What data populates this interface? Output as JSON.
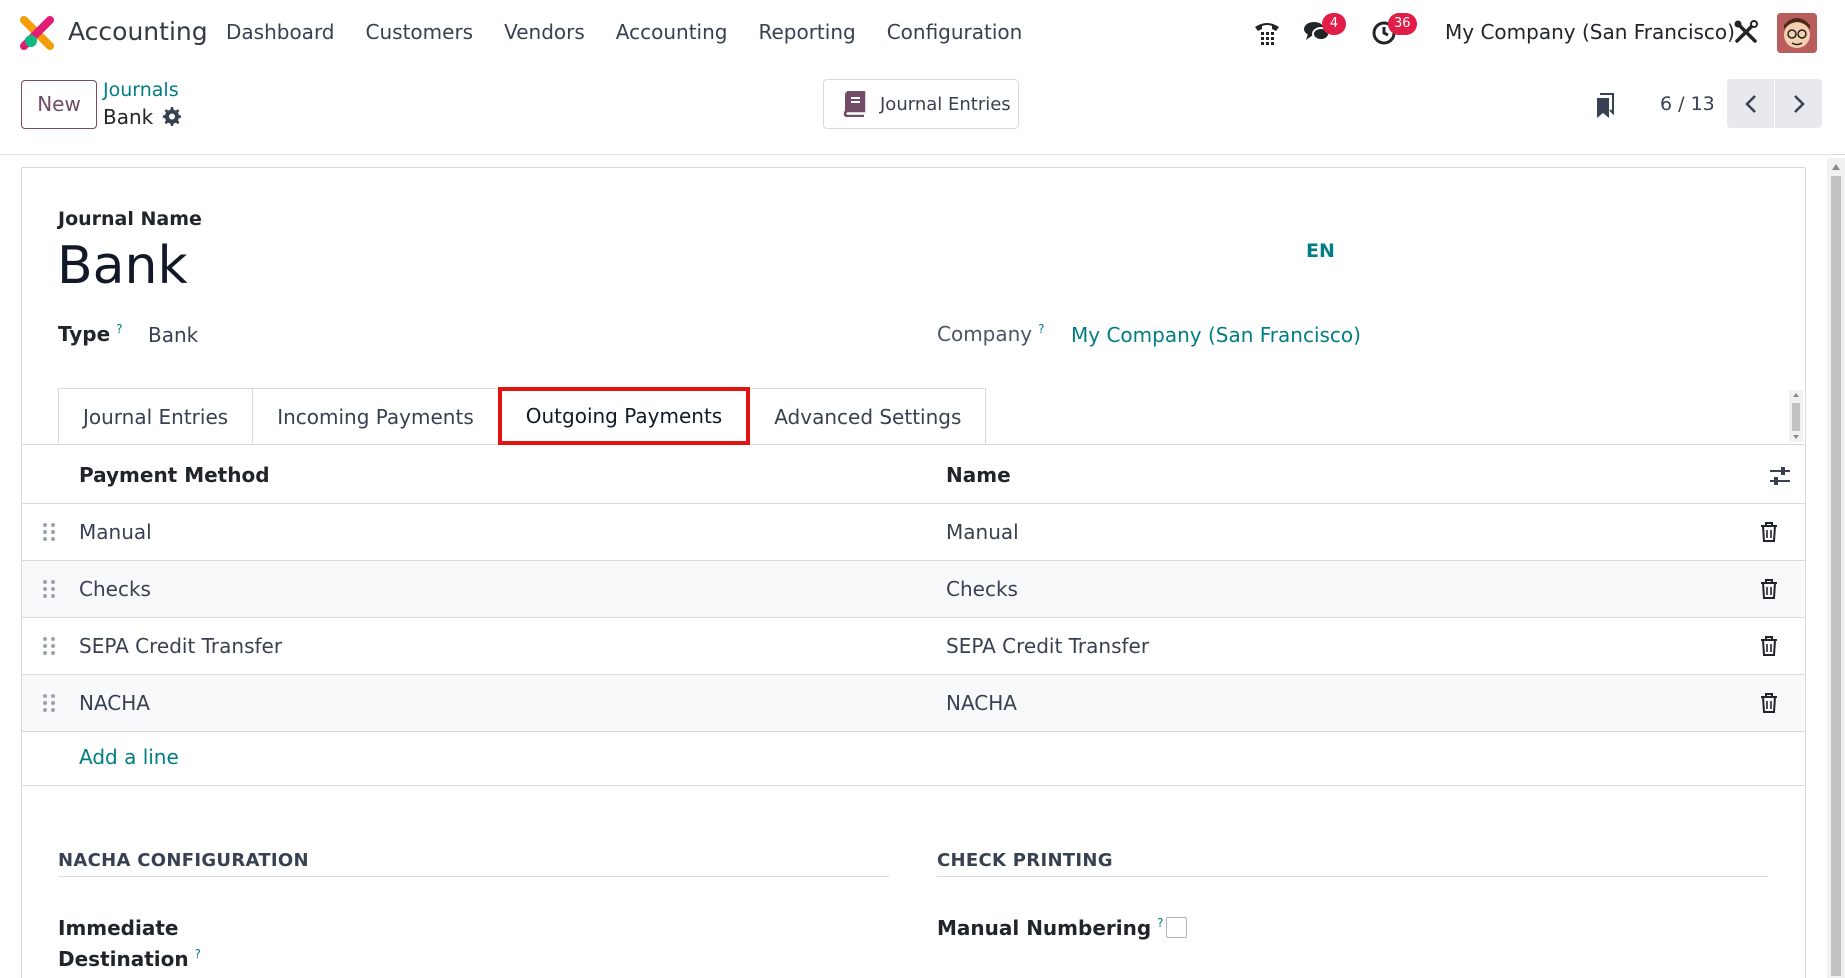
{
  "navbar": {
    "app_name": "Accounting",
    "menu": [
      "Dashboard",
      "Customers",
      "Vendors",
      "Accounting",
      "Reporting",
      "Configuration"
    ],
    "messages_count": "4",
    "activities_count": "36",
    "company": "My Company (San Francisco)"
  },
  "control": {
    "new_label": "New",
    "breadcrumb_parent": "Journals",
    "breadcrumb_current": "Bank",
    "smart_button_label": "Journal Entries",
    "pager": "6 / 13"
  },
  "form": {
    "name_caption": "Journal Name",
    "name": "Bank",
    "lang": "EN",
    "type_label": "Type",
    "type_value": "Bank",
    "company_label": "Company",
    "company_value": "My Company (San Francisco)",
    "help_mark": "?"
  },
  "tabs": [
    "Journal Entries",
    "Incoming Payments",
    "Outgoing Payments",
    "Advanced Settings"
  ],
  "active_tab": "Outgoing Payments",
  "payment_table": {
    "headers": [
      "Payment Method",
      "Name"
    ],
    "rows": [
      {
        "method": "Manual",
        "name": "Manual"
      },
      {
        "method": "Checks",
        "name": "Checks"
      },
      {
        "method": "SEPA Credit Transfer",
        "name": "SEPA Credit Transfer"
      },
      {
        "method": "NACHA",
        "name": "NACHA"
      }
    ],
    "add_line": "Add a line"
  },
  "sections": {
    "nacha_title": "NACHA CONFIGURATION",
    "immediate_destination_line1": "Immediate",
    "immediate_destination_line2": "Destination",
    "check_title": "CHECK PRINTING",
    "manual_numbering": "Manual Numbering"
  },
  "colors": {
    "brand": "#714b67",
    "link": "#017e84",
    "highlight": "#e11414",
    "badge": "#e11d48"
  }
}
